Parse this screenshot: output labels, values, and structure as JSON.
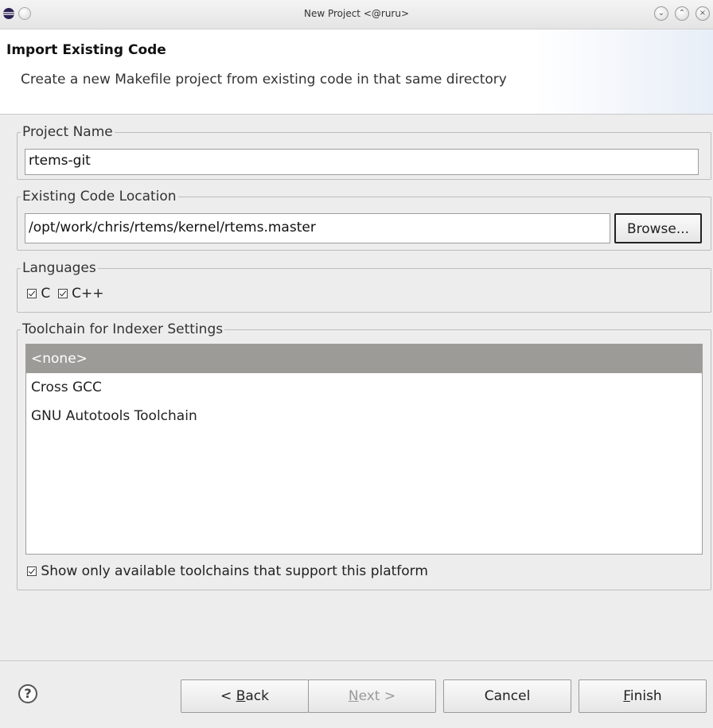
{
  "window": {
    "title": "New Project  <@ruru>"
  },
  "header": {
    "heading": "Import Existing Code",
    "description": "Create a new Makefile project from existing code in that same directory"
  },
  "project_name": {
    "legend": "Project Name",
    "value": "rtems-git"
  },
  "code_location": {
    "legend": "Existing Code Location",
    "value": "/opt/work/chris/rtems/kernel/rtems.master",
    "browse_label": "Browse..."
  },
  "languages": {
    "legend": "Languages",
    "items": [
      {
        "label": "C",
        "checked": true
      },
      {
        "label": "C++",
        "checked": true
      }
    ]
  },
  "toolchain": {
    "legend": "Toolchain for Indexer Settings",
    "items": [
      {
        "label": "<none>",
        "selected": true
      },
      {
        "label": "Cross GCC",
        "selected": false
      },
      {
        "label": "GNU Autotools Toolchain",
        "selected": false
      }
    ],
    "show_only_label": "Show only available toolchains that support this platform",
    "show_only_checked": true
  },
  "footer": {
    "help_icon": "?",
    "back_prefix": "< ",
    "back_mnemonic": "B",
    "back_rest": "ack",
    "next_mnemonic": "N",
    "next_rest": "ext >",
    "cancel_label": "Cancel",
    "finish_mnemonic": "F",
    "finish_rest": "inish"
  }
}
